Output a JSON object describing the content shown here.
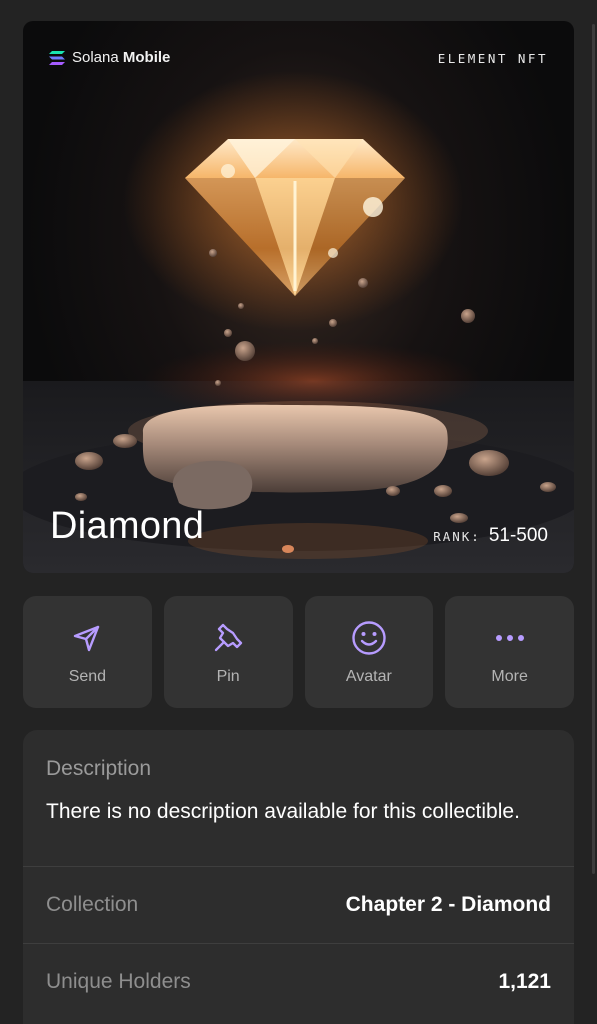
{
  "nft": {
    "brand": {
      "name_light": "Solana",
      "name_bold": "Mobile",
      "logo_colors": [
        "#00ffa3",
        "#9945ff"
      ]
    },
    "tag": "ELEMENT NFT",
    "name": "Diamond",
    "rank_label": "RANK:",
    "rank_value": "51-500"
  },
  "actions": [
    {
      "label": "Send",
      "icon": "paper-plane-icon"
    },
    {
      "label": "Pin",
      "icon": "pushpin-icon"
    },
    {
      "label": "Avatar",
      "icon": "smiley-face-icon"
    },
    {
      "label": "More",
      "icon": "ellipsis-icon"
    }
  ],
  "details": {
    "description_title": "Description",
    "description_text": "There is no description available for this collectible.",
    "rows": [
      {
        "label": "Collection",
        "value": "Chapter 2 - Diamond"
      },
      {
        "label": "Unique Holders",
        "value": "1,121"
      }
    ]
  },
  "colors": {
    "accent": "#b79cff",
    "background": "#232323",
    "tile": "#333333",
    "panel": "#2d2d2d"
  }
}
